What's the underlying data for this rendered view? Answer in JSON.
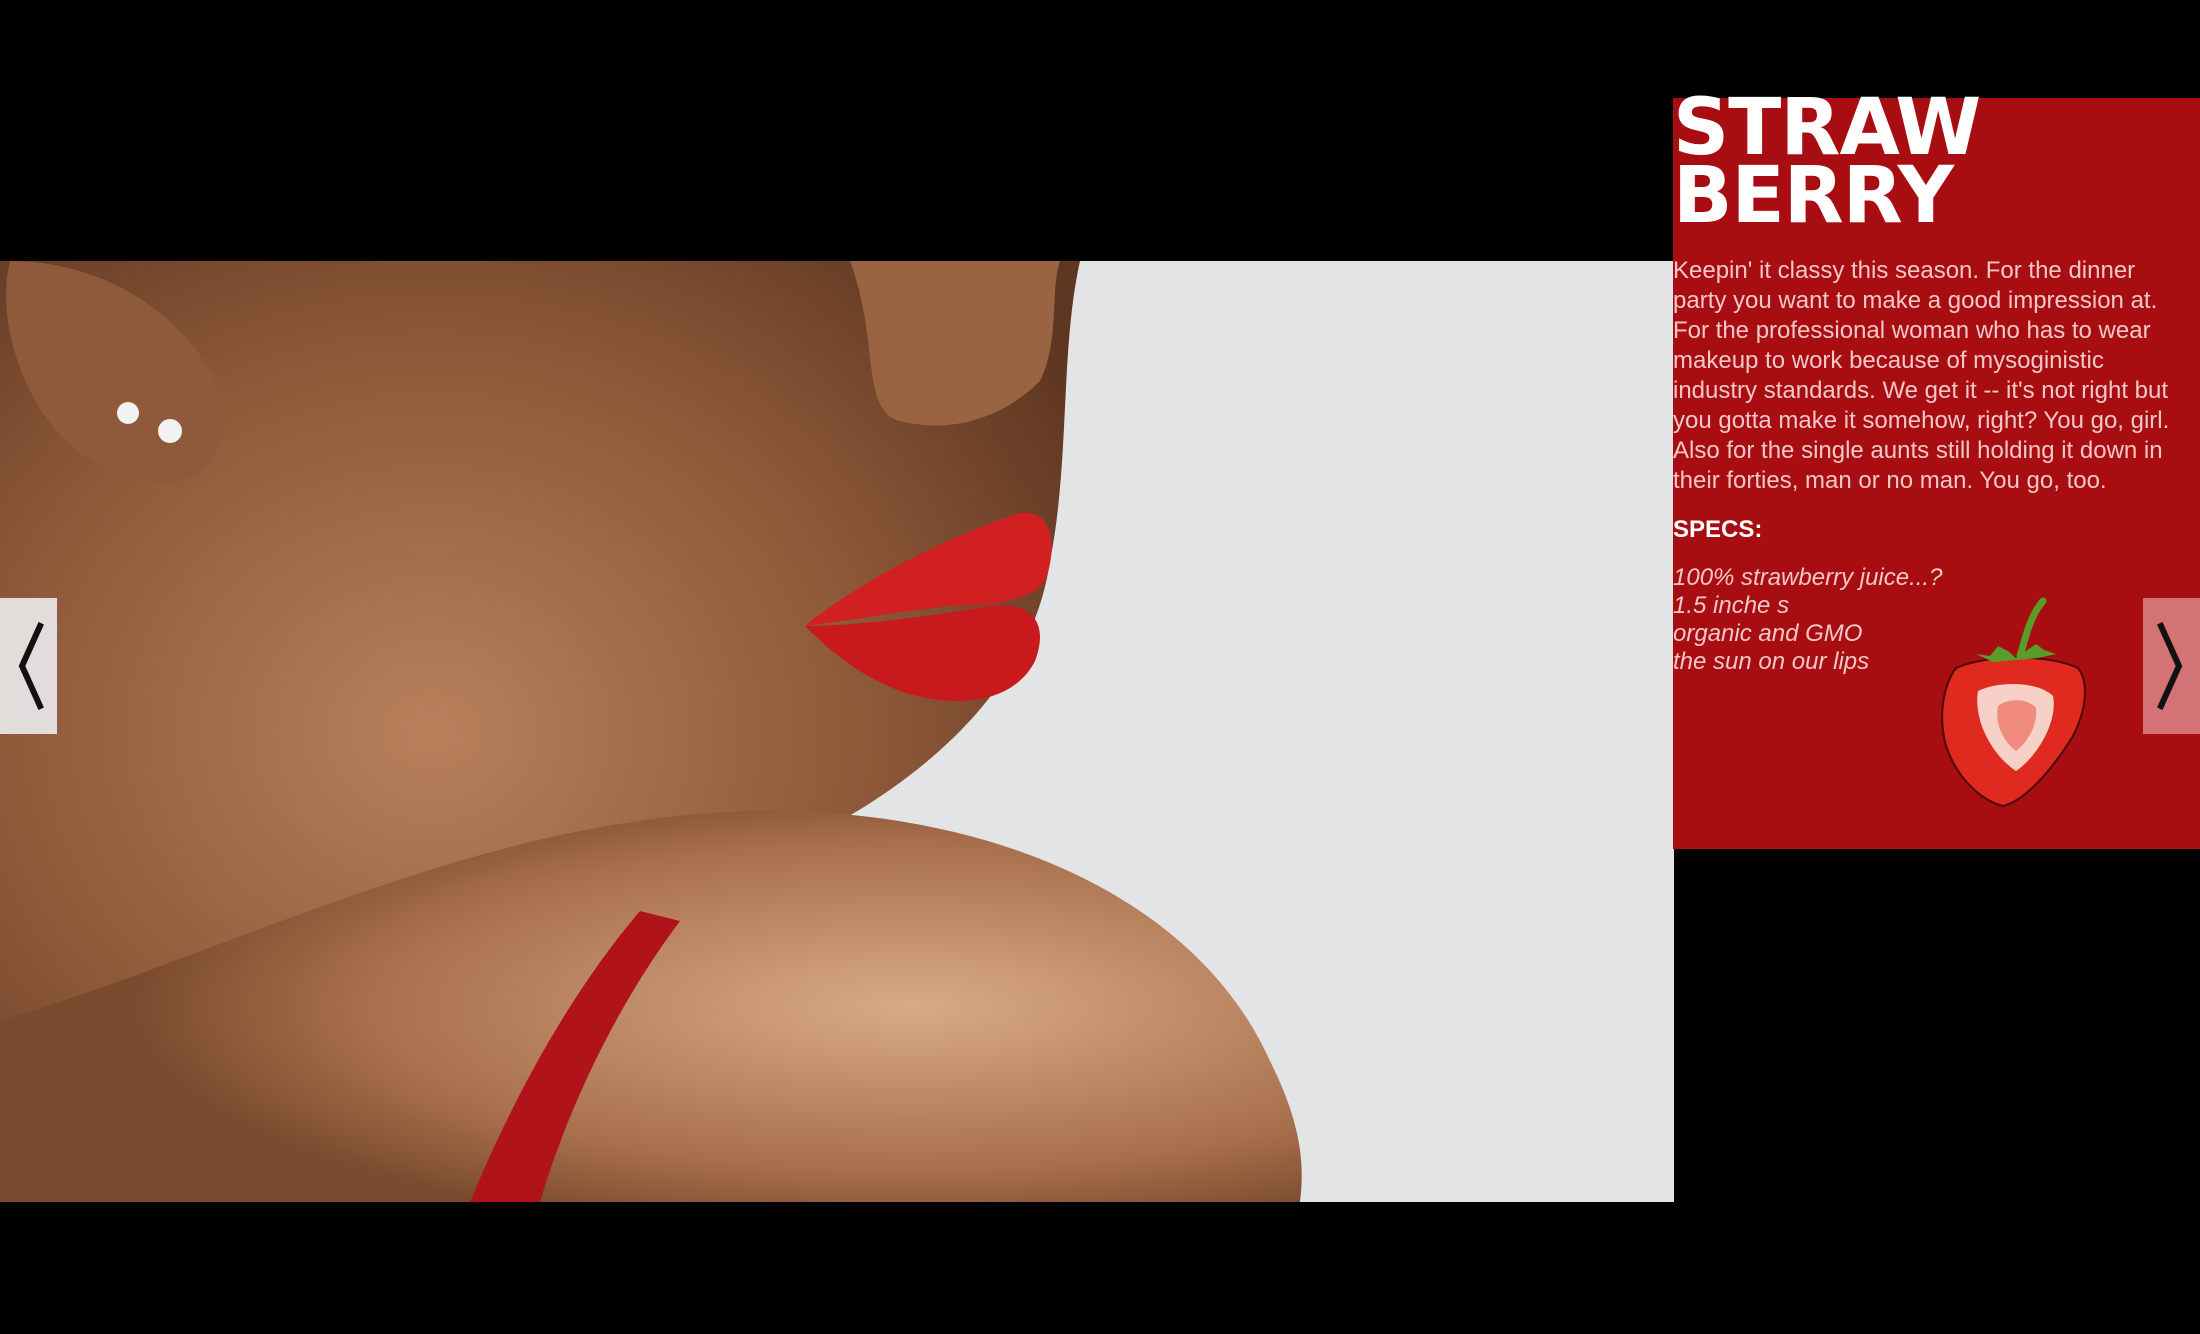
{
  "product": {
    "title_line1": "STRAW",
    "title_line2": "BERRY",
    "description": "Keepin' it classy this season. For the dinner party you want to make a good impression at. For the professional woman who has to wear makeup to work because of mysoginistic industry standards. We get it -- it's not right but you gotta make it somehow, right? You go, girl. Also for the single aunts still holding it down in their forties, man or no man. You go, too.",
    "specs_heading": "SPECS:",
    "specs": [
      "100% strawberry juice...?",
      "1.5 inche s",
      "organic and GMO",
      "the sun on our lips"
    ]
  },
  "icons": {
    "prev": "chevron-left-icon",
    "next": "chevron-right-icon",
    "product_graphic": "strawberry-icon"
  },
  "colors": {
    "panel": "#a80d12",
    "background": "#000000",
    "lips": "#d21f22"
  }
}
